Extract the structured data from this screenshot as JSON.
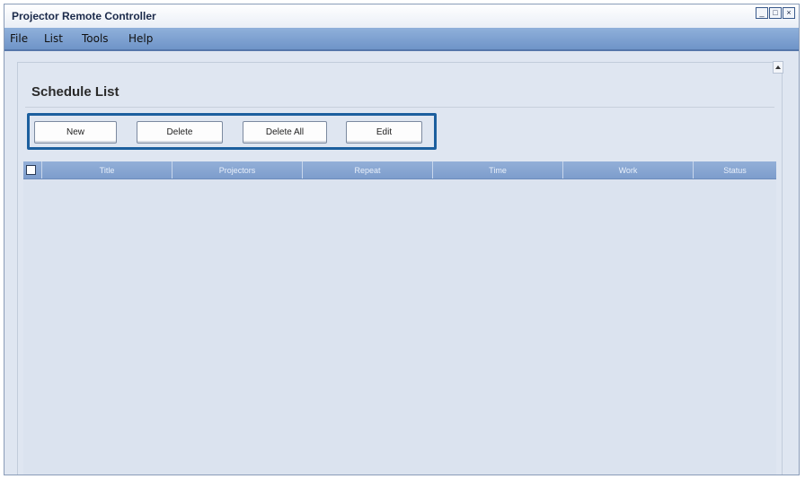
{
  "window": {
    "title": "Projector Remote Controller"
  },
  "menu": {
    "items": [
      "File",
      "List",
      "Tools",
      "Help"
    ]
  },
  "page": {
    "title": "Schedule List"
  },
  "toolbar": {
    "buttons": [
      "New",
      "Delete",
      "Delete All",
      "Edit"
    ]
  },
  "table": {
    "columns": [
      "Title",
      "Projectors",
      "Repeat",
      "Time",
      "Work",
      "Status"
    ],
    "rows": []
  },
  "colors": {
    "accent": "#1c5f9e",
    "menubar": "#7a9dcf",
    "header": "#88a7d3"
  },
  "icons": [
    "minimize-icon",
    "maximize-icon",
    "close-icon",
    "scroll-up-icon"
  ]
}
